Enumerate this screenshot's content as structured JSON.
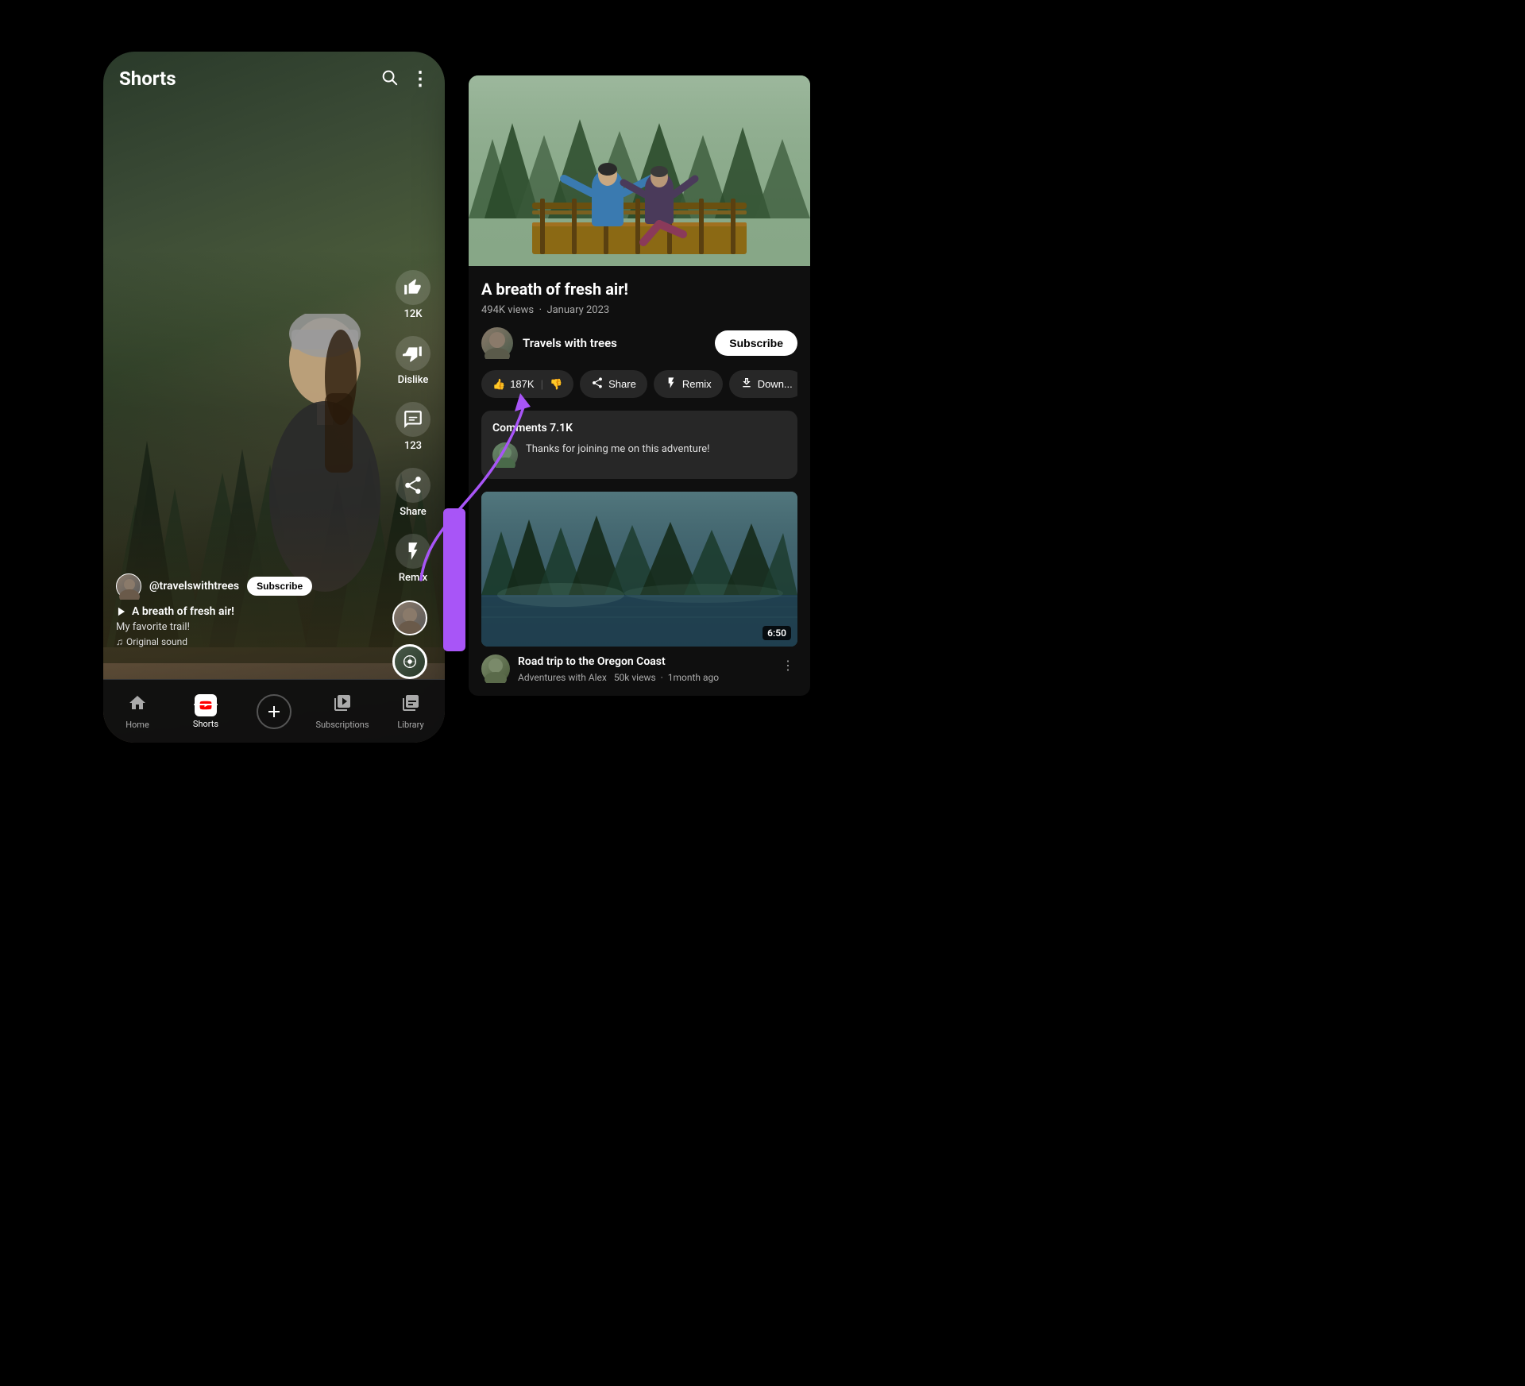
{
  "page": {
    "background_color": "#000000"
  },
  "phone": {
    "title": "Shorts",
    "header_icons": [
      "search",
      "more_vert"
    ],
    "video": {
      "channel_handle": "@travelswithtrees",
      "subscribe_label": "Subscribe",
      "title": "A breath of fresh air!",
      "description": "My favorite trail!",
      "sound": "Original sound",
      "like_count": "12K",
      "dislike_label": "Dislike",
      "comments_count": "123",
      "share_label": "Share",
      "remix_label": "Remix"
    },
    "nav": {
      "items": [
        {
          "id": "home",
          "label": "Home",
          "active": false
        },
        {
          "id": "shorts",
          "label": "Shorts",
          "active": true
        },
        {
          "id": "create",
          "label": "",
          "active": false
        },
        {
          "id": "subscriptions",
          "label": "Subscriptions",
          "active": false
        },
        {
          "id": "library",
          "label": "Library",
          "active": false
        }
      ]
    }
  },
  "desktop": {
    "video": {
      "title": "A breath of fresh air!",
      "views": "494K views",
      "date": "January 2023",
      "channel_name": "Travels with trees",
      "subscribe_label": "Subscribe",
      "like_count": "187K",
      "actions": [
        {
          "id": "like",
          "label": "187K",
          "icon": "👍"
        },
        {
          "id": "dislike",
          "label": "",
          "icon": "👎"
        },
        {
          "id": "share",
          "label": "Share",
          "icon": "↗"
        },
        {
          "id": "remix",
          "label": "Remix",
          "icon": "⚡"
        },
        {
          "id": "download",
          "label": "Down...",
          "icon": "⬇"
        }
      ],
      "comments": {
        "header": "Comments 7.1K",
        "preview": "Thanks for joining me on this adventure!"
      },
      "related": {
        "title": "Road trip to the Oregon Coast",
        "channel": "Adventures with Alex",
        "views": "50k views",
        "time_ago": "1month ago",
        "duration": "6:50"
      }
    }
  },
  "icons": {
    "search": "🔍",
    "more_vert": "⋮",
    "home": "⌂",
    "shorts": "▶",
    "create": "+",
    "subscriptions": "📺",
    "library": "📚",
    "thumbs_up": "👍",
    "thumbs_down": "👎",
    "comment": "💬",
    "share": "↗",
    "remix": "⚡",
    "music_note": "♫",
    "play": "▷"
  }
}
